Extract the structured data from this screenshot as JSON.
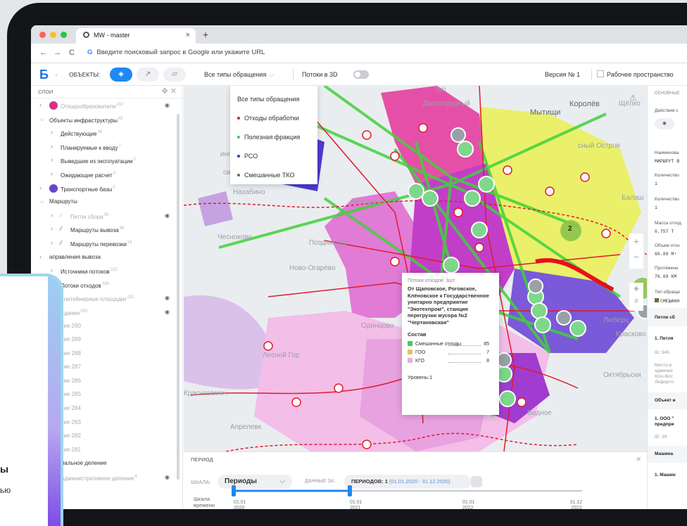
{
  "browser": {
    "tab_title": "MW - master",
    "tab_close": "×",
    "new_tab": "+",
    "url_placeholder": "Введите поисковый запрос в Google или укажите URL"
  },
  "toolbar": {
    "objects_label": "ОБЪЕКТЫ:",
    "types_select": "Все типы обращения",
    "flows3d_label": "Потоки в 3D",
    "version_label": "Версия № 1",
    "workspace_label": "Рабочее пространство"
  },
  "layers": {
    "header": "СЛОИ",
    "items": [
      {
        "label": "Отходообразователи",
        "count": "292",
        "faded": true
      },
      {
        "label": "Объекты инфраструктуры",
        "count": "45"
      },
      {
        "label": "Действующие",
        "count": "38"
      },
      {
        "label": "Планируемые к вводу",
        "count": "7"
      },
      {
        "label": "Выведшие из эксплуатации",
        "count": "0"
      },
      {
        "label": "Ожидающие расчет",
        "count": "0"
      },
      {
        "label": "Транспортные базы",
        "count": "0"
      },
      {
        "label": "Маршруты",
        "count": ""
      },
      {
        "label": "Петли сбора",
        "count": "59",
        "faded": true
      },
      {
        "label": "Маршруты вывоза",
        "count": "88"
      },
      {
        "label": "Маршруты перевозки",
        "count": "16"
      },
      {
        "label": "аправления вывоза",
        "count": ""
      },
      {
        "label": "Источники потоков",
        "count": "322"
      },
      {
        "label": "Потоки отходов",
        "count": "338"
      },
      {
        "label": "Контейнерные площадки",
        "count": "281",
        "faded": true
      },
      {
        "label": "Здания",
        "count": "290",
        "faded": true
      },
      {
        "label": "ние 290",
        "count": "",
        "faded": true
      },
      {
        "label": "ние 289",
        "count": "",
        "faded": true
      },
      {
        "label": "ние 288",
        "count": "",
        "faded": true
      },
      {
        "label": "ние 287",
        "count": "",
        "faded": true
      },
      {
        "label": "ние 286",
        "count": "",
        "faded": true
      },
      {
        "label": "ние 285",
        "count": "",
        "faded": true
      },
      {
        "label": "ние 284",
        "count": "",
        "faded": true
      },
      {
        "label": "ние 283",
        "count": "",
        "faded": true
      },
      {
        "label": "ние 282",
        "count": "",
        "faded": true
      },
      {
        "label": "ние 281",
        "count": "",
        "faded": true
      },
      {
        "label": "иториальное деление",
        "count": ""
      },
      {
        "label": "Административное деление",
        "count": "4",
        "faded": true
      }
    ]
  },
  "dropdown": {
    "items": [
      {
        "label": "Все типы обращения",
        "color": ""
      },
      {
        "label": "Отходы обработки",
        "color": "#d0223c"
      },
      {
        "label": "Полезная фракция",
        "color": "#3ccf5a"
      },
      {
        "label": "РСО",
        "color": "#2a3db8"
      },
      {
        "label": "Смешанные ТКО",
        "color": "#6b6b4a"
      }
    ]
  },
  "map": {
    "labels": [
      "Долгопрудный",
      "Мытищи",
      "Королёв",
      "Щёлко",
      "сный Остров",
      "Балаш",
      "Нахабино",
      "Красногорс",
      "Чесноково",
      "Поздняково",
      "Ново-Огарёво",
      "Одинцово",
      "Лесной Гор",
      "Краснозамен",
      "Апрелевк",
      "Видное",
      "Октябрьски",
      "Красково",
      "Люберц",
      "Зуо",
      "ово",
      "ино"
    ],
    "clusters": [
      "2",
      "2"
    ]
  },
  "popup": {
    "caption": "Потоки отходов: 3шт",
    "title": "От Щаповское, Роговское, Клёновское к Государственное унитарно предприятие \"Экотехпром\", станция перегрузки мусора №2 \"Чертановская\"",
    "section": "Состав",
    "rows": [
      {
        "label": "Смешанные отходы",
        "value": "85",
        "color": "#3ccf5a"
      },
      {
        "label": "ГОО",
        "value": "7",
        "color": "#e5c55a"
      },
      {
        "label": "КГО",
        "value": "8",
        "color": "#e8b0d6"
      }
    ],
    "level": "Уровень:1"
  },
  "period": {
    "header": "ПЕРИОД",
    "close": "×",
    "scale_label": "ШКАЛА:",
    "scale_value": "Периоды",
    "data_label": "ДАННЫЕ ЗА:",
    "periods_bold": "ПЕРИОДОВ: 1",
    "periods_range": "(01.01.2020 - 31.12.2020)",
    "timeline_label": "Шкала времени",
    "ticks": [
      {
        "d": "01.01",
        "y": "2020"
      },
      {
        "d": "01.01",
        "y": "2021"
      },
      {
        "d": "01.01",
        "y": "2022"
      },
      {
        "d": "31.12",
        "y": "2022"
      }
    ]
  },
  "details": {
    "header": "ОСНОВНЫЕ",
    "actions": "Действия с",
    "name_label": "Наименова",
    "name_value": "МАРШРУТ В",
    "qty1_label": "Количество",
    "qty1_value": "1",
    "qty2_label": "Количество",
    "qty2_value": "1",
    "mass_label": "Масса отход",
    "mass_value": "6.757 Т",
    "volume_label": "Объем отхо",
    "volume_value": "60.89 М³",
    "length_label": "Протяженн",
    "length_value": "76.69 КМ",
    "type_label": "Тип обраще",
    "type_value": "СМЕШАНН",
    "loops_head": "Петли сб",
    "loop_item": "1. Петля",
    "loop_id": "ID: 945",
    "loop_desc1": "Место в",
    "loop_desc2": "админис",
    "loop_desc3": "Юго-Вос",
    "loop_desc4": "Лефорто",
    "object_head": "Объект и",
    "object_item": "1. ООО \"",
    "object_item2": "предпри",
    "object_id": "ID: 39",
    "machine_head": "Машина",
    "machine_item": "1. Машин"
  },
  "overlay": {
    "line1": "ы",
    "line2": "ью"
  }
}
